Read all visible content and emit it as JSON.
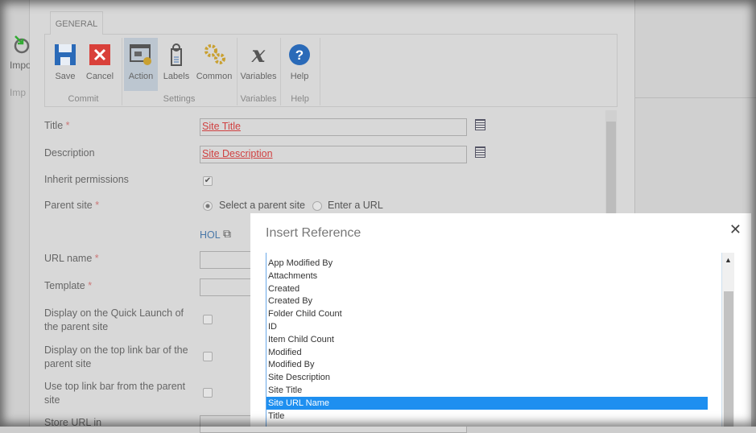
{
  "background": {
    "import_label": "Impo",
    "import_group": "Imp"
  },
  "ribbon": {
    "tab": "GENERAL",
    "buttons": [
      {
        "label": "Save"
      },
      {
        "label": "Cancel"
      },
      {
        "label": "Action"
      },
      {
        "label": "Labels"
      },
      {
        "label": "Common"
      },
      {
        "label": "Variables"
      },
      {
        "label": "Help"
      }
    ],
    "groups": [
      "Commit",
      "Settings",
      "Variables",
      "Help"
    ]
  },
  "form": {
    "title_label": "Title",
    "title_value": "Site Title",
    "description_label": "Description",
    "description_value": "Site Description",
    "inherit_label": "Inherit permissions",
    "inherit_checked": true,
    "parent_label": "Parent site",
    "parent_opt1": "Select a parent site",
    "parent_opt2": "Enter a URL",
    "parent_link": "HOL",
    "url_label": "URL name",
    "template_label": "Template",
    "quicklaunch_label": "Display on the Quick Launch of the parent site",
    "toplink_label": "Display on the top link bar of the parent site",
    "usetop_label": "Use top link bar from the parent site",
    "store_label": "Store URL in",
    "required": "*"
  },
  "dialog": {
    "title": "Insert Reference",
    "close": "✕",
    "items": [
      "App Modified By",
      "Attachments",
      "Created",
      "Created By",
      "Folder Child Count",
      "ID",
      "Item Child Count",
      "Modified",
      "Modified By",
      "Site Description",
      "Site Title",
      "Site URL Name",
      "Title"
    ],
    "selected": "Site URL Name"
  }
}
